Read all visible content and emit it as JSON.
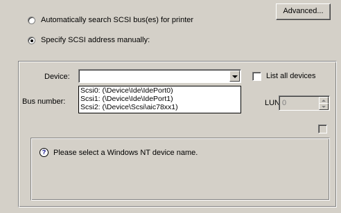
{
  "options": {
    "auto_search_label": "Automatically search SCSI bus(es) for printer",
    "manual_label": "Specify SCSI address manually:",
    "selected": "manual"
  },
  "advanced_button_label": "Advanced...",
  "form": {
    "device_label": "Device:",
    "device_value": "",
    "list_all_label": "List all devices",
    "bus_label": "Bus number:",
    "lun_label": "LUN:",
    "lun_value": "0",
    "dropdown_options": [
      "Scsi0: (\\Device\\Ide\\IdePort0)",
      "Scsi1: (\\Device\\Ide\\IdePort1)",
      "Scsi2: (\\Device\\Scsi\\aic78xx1)"
    ]
  },
  "info": {
    "message": "Please select a Windows NT device name.",
    "icon": "question-icon"
  }
}
